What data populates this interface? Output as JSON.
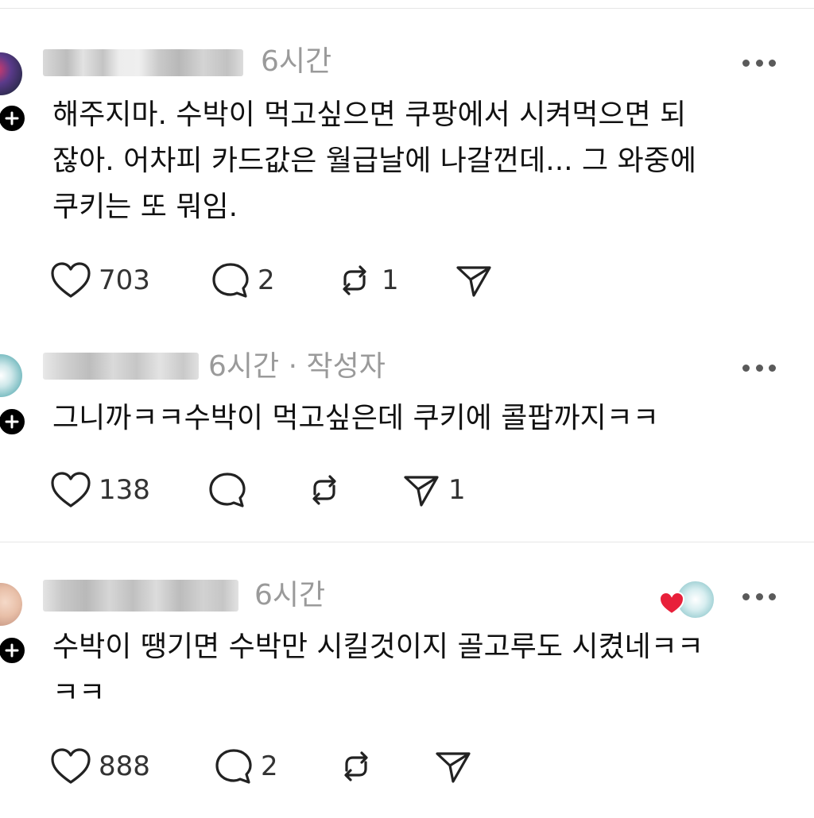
{
  "posts": [
    {
      "time": "6시간",
      "author_tag": "",
      "text_lines": [
        "해주지마. 수박이 먹고싶으면 쿠팡에서 시켜먹으면 되",
        "잖아. 어차피 카드값은 월급날에 나갈껀데... 그 와중에",
        "쿠키는 또 뭐임."
      ],
      "likes": "703",
      "replies": "2",
      "reposts": "1",
      "shares": ""
    },
    {
      "time": "6시간",
      "author_tag": "· 작성자",
      "text_lines": [
        "그니까ㅋㅋ수박이 먹고싶은데 쿠키에 콜팝까지ㅋㅋ"
      ],
      "likes": "138",
      "replies": "",
      "reposts": "",
      "shares": "1"
    },
    {
      "time": "6시간",
      "author_tag": "",
      "text_lines": [
        "수박이 땡기면 수박만 시킬것이지 골고루도 시켰네ㅋㅋ",
        "ㅋㅋ"
      ],
      "likes": "888",
      "replies": "2",
      "reposts": "",
      "shares": ""
    }
  ],
  "icons": {
    "like": "heart-icon",
    "reply": "comment-icon",
    "repost": "repost-icon",
    "share": "send-icon",
    "more": "more-icon",
    "follow": "plus-icon"
  },
  "colors": {
    "meta_text": "#9a9a9a",
    "liked_heart": "#e8203a"
  }
}
